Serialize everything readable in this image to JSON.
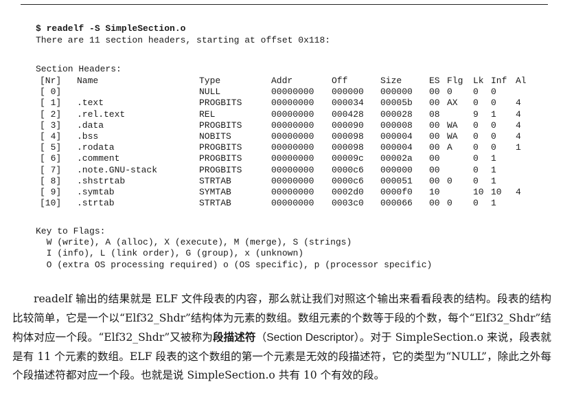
{
  "command": "$ readelf -S SimpleSection.o",
  "summary": "There are 11 section headers, starting at offset 0x118:",
  "table_title": "Section Headers:",
  "columns": [
    "[Nr]",
    "Name",
    "Type",
    "Addr",
    "Off",
    "Size",
    "ES",
    "Flg",
    "Lk",
    "Inf",
    "Al"
  ],
  "rows": [
    [
      "[ 0]",
      "",
      "NULL",
      "00000000",
      "000000",
      "000000",
      "00",
      "0",
      "0",
      "0",
      ""
    ],
    [
      "[ 1]",
      ".text",
      "PROGBITS",
      "00000000",
      "000034",
      "00005b",
      "00",
      "AX",
      "0",
      "0",
      "4"
    ],
    [
      "[ 2]",
      ".rel.text",
      "REL",
      "00000000",
      "000428",
      "000028",
      "08",
      "",
      "9",
      "1",
      "4"
    ],
    [
      "[ 3]",
      ".data",
      "PROGBITS",
      "00000000",
      "000090",
      "000008",
      "00",
      "WA",
      "0",
      "0",
      "4"
    ],
    [
      "[ 4]",
      ".bss",
      "NOBITS",
      "00000000",
      "000098",
      "000004",
      "00",
      "WA",
      "0",
      "0",
      "4"
    ],
    [
      "[ 5]",
      ".rodata",
      "PROGBITS",
      "00000000",
      "000098",
      "000004",
      "00",
      "A",
      "0",
      "0",
      "1"
    ],
    [
      "[ 6]",
      ".comment",
      "PROGBITS",
      "00000000",
      "00009c",
      "00002a",
      "00",
      "",
      "0",
      "1",
      ""
    ],
    [
      "[ 7]",
      ".note.GNU-stack",
      "PROGBITS",
      "00000000",
      "0000c6",
      "000000",
      "00",
      "",
      "0",
      "1",
      ""
    ],
    [
      "[ 8]",
      ".shstrtab",
      "STRTAB",
      "00000000",
      "0000c6",
      "000051",
      "00",
      "0",
      "0",
      "1",
      ""
    ],
    [
      "[ 9]",
      ".symtab",
      "SYMTAB",
      "00000000",
      "0002d0",
      "0000f0",
      "10",
      "",
      "10",
      "10",
      "4"
    ],
    [
      "[10]",
      ".strtab",
      "STRTAB",
      "00000000",
      "0003c0",
      "000066",
      "00",
      "0",
      "0",
      "1",
      ""
    ]
  ],
  "flags_title": "Key to Flags:",
  "flags_lines": [
    "  W (write), A (alloc), X (execute), M (merge), S (strings)",
    "  I (info), L (link order), G (group), x (unknown)",
    "  O (extra OS processing required) o (OS specific), p (processor specific)"
  ],
  "prose": {
    "p1": "readelf 输出的结果就是 ELF 文件段表的内容，那么就让我们对照这个输出来看看段表的结构。段表的结构比较简单，它是一个以“Elf32_Shdr”结构体为元素的数组。数组元素的个数等于段的个数，每个“Elf32_Shdr”结构体对应一个段。“Elf32_Shdr”又被称为",
    "bold_term": "段描述符",
    "paren_open": "（",
    "english_term": "Section Descriptor",
    "p2": "）。对于 SimpleSection.o 来说，段表就是有 11 个元素的数组。ELF 段表的这个数组的第一个元素是无效的段描述符，它的类型为“NULL”，除此之外每个段描述符都对应一个段。也就是说 SimpleSection.o 共有 10 个有效的段。"
  }
}
